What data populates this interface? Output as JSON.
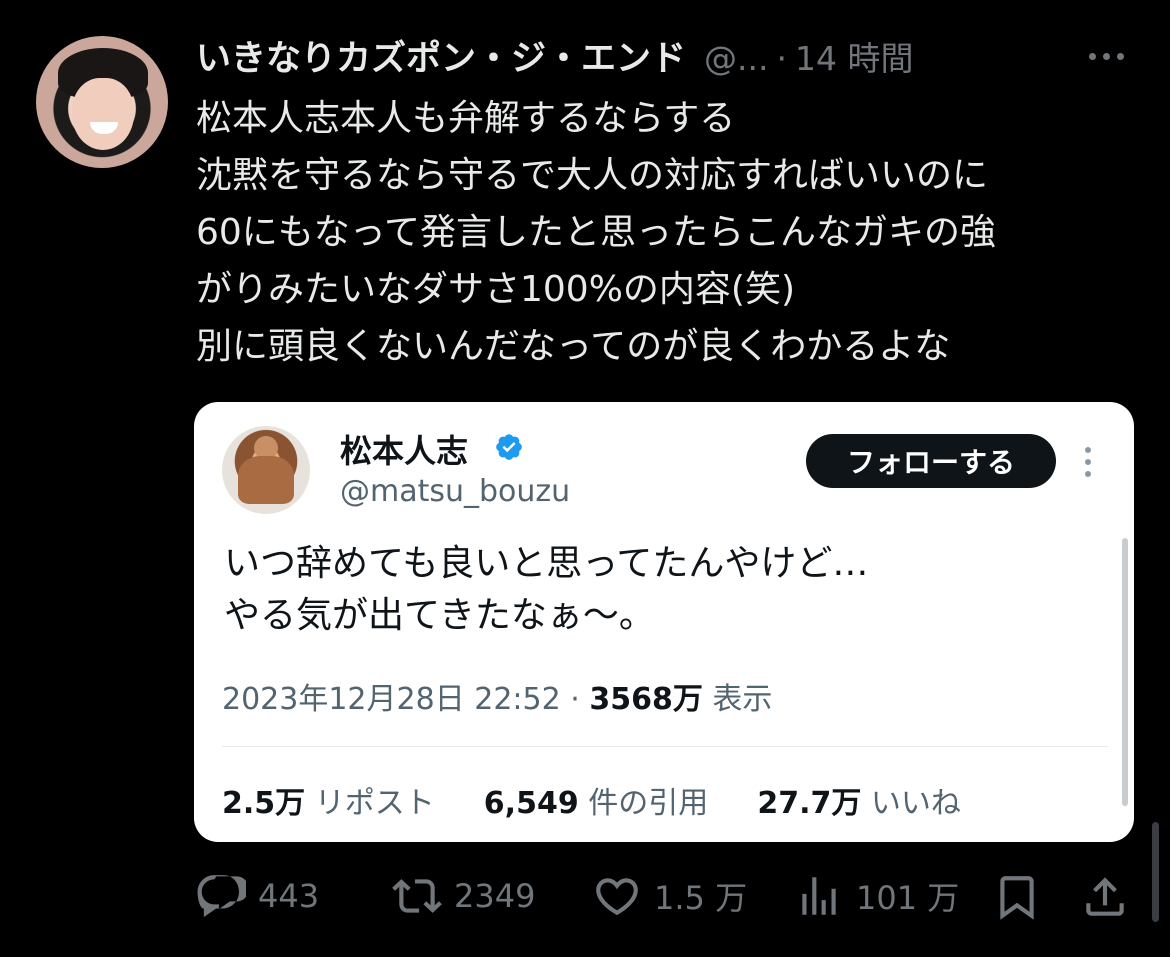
{
  "tweet": {
    "author_name": "いきなりカズポン・ジ・エンド",
    "author_handle": "@...",
    "separator": "·",
    "time": "14 時間",
    "text_lines": [
      "松本人志本人も弁解するならする",
      "沈黙を守るなら守るで大人の対応すればいいのに",
      "60にもなって発言したと思ったらこんなガキの強",
      "がりみたいなダサさ100%の内容(笑)",
      "別に頭良くないんだなってのが良くわかるよな"
    ]
  },
  "quoted": {
    "author_name": "松本人志",
    "author_handle": "@matsu_bouzu",
    "follow_label": "フォローする",
    "text_lines": [
      "いつ辞めても良いと思ってたんやけど…",
      "やる気が出てきたなぁ～。"
    ],
    "datetime": "2023年12月28日 22:52",
    "meta_separator": "·",
    "views_count": "3568万",
    "views_label": "表示",
    "reposts_count": "2.5万",
    "reposts_label": "リポスト",
    "quotes_count": "6,549",
    "quotes_label": "件の引用",
    "likes_count": "27.7万",
    "likes_label": "いいね"
  },
  "actions": {
    "replies": "443",
    "retweets": "2349",
    "likes": "1.5 万",
    "views": "101 万"
  },
  "colors": {
    "background": "#000000",
    "text_primary": "#e7e9ea",
    "text_secondary": "#71767b",
    "verified_blue": "#1d9bf0",
    "follow_button_bg": "#0f1419"
  },
  "icons": [
    "more-icon",
    "verified-icon",
    "reply-icon",
    "retweet-icon",
    "like-icon",
    "views-icon",
    "bookmark-icon",
    "share-icon"
  ]
}
